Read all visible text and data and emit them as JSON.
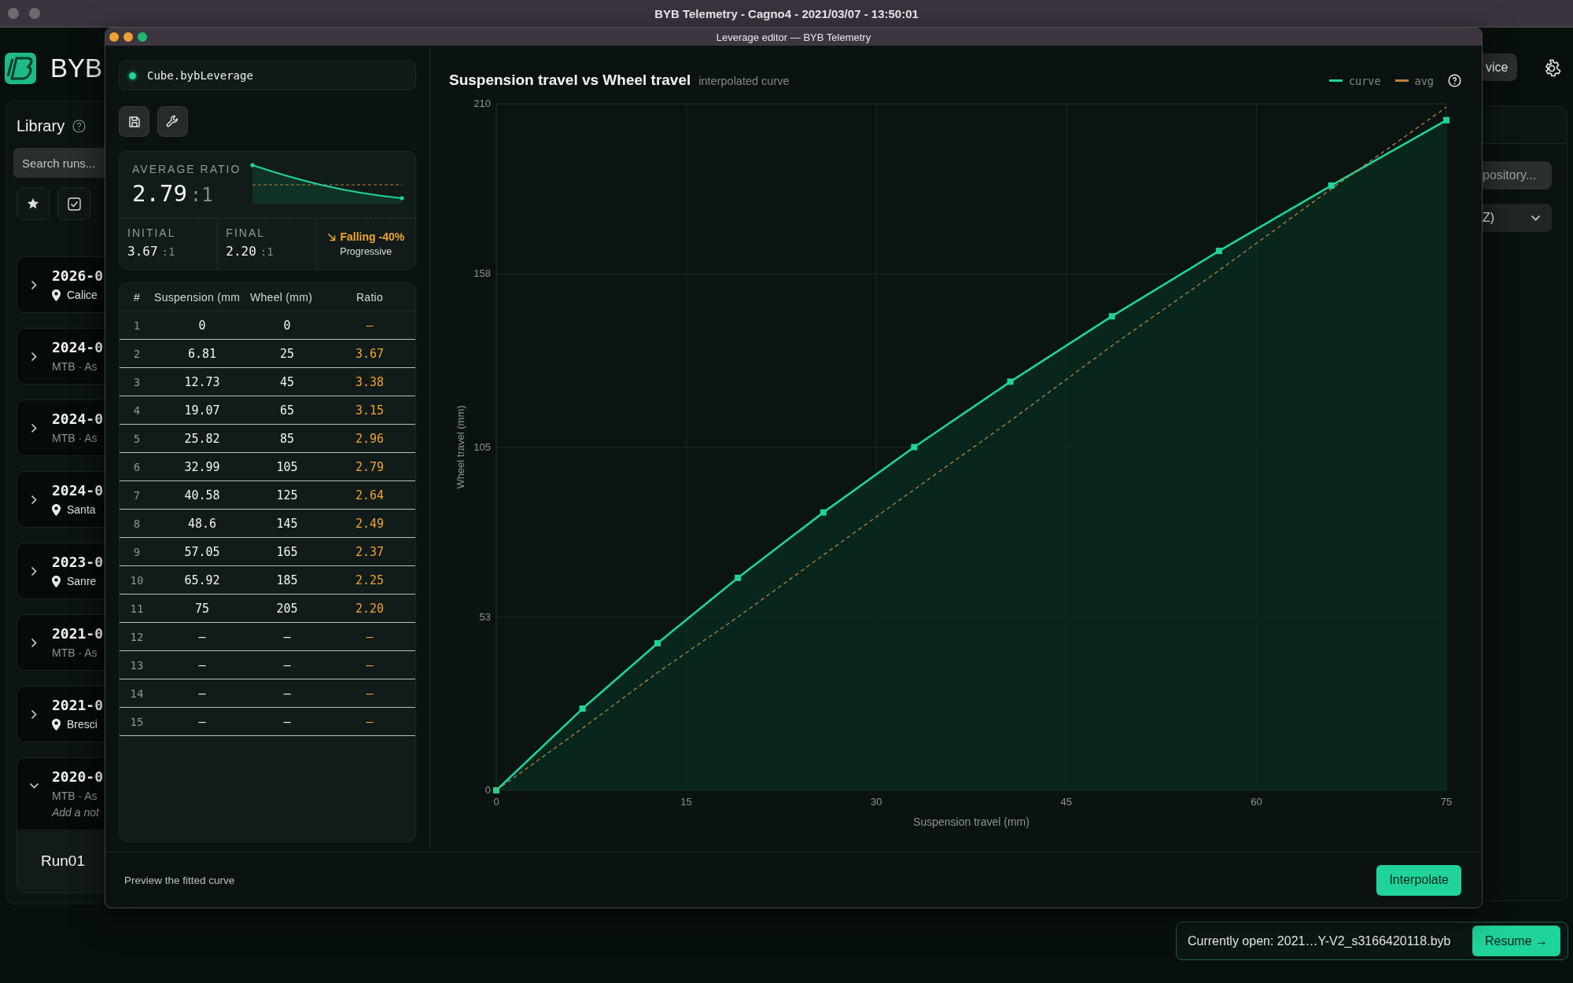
{
  "window": {
    "title": "BYB Telemetry - Cagno4 - 2021/03/07 - 13:50:01"
  },
  "brand": {
    "name": "BYB"
  },
  "library": {
    "title": "Library",
    "search": {
      "placeholder": "Search runs..."
    },
    "runs": [
      {
        "date": "2026-0",
        "kind": "place",
        "detail": "Calice",
        "expanded": false
      },
      {
        "date": "2024-0",
        "kind": "meta",
        "detail": "MTB · As",
        "expanded": false
      },
      {
        "date": "2024-0",
        "kind": "meta",
        "detail": "MTB · As",
        "expanded": false
      },
      {
        "date": "2024-0",
        "kind": "place",
        "detail": "Santa",
        "expanded": false
      },
      {
        "date": "2023-0",
        "kind": "place",
        "detail": "Sanre",
        "expanded": false
      },
      {
        "date": "2021-0",
        "kind": "meta",
        "detail": "MTB · As",
        "expanded": false
      },
      {
        "date": "2021-0",
        "kind": "place",
        "detail": "Bresci",
        "expanded": false
      },
      {
        "date": "2020-0",
        "kind": "meta",
        "detail": "MTB · As",
        "expanded": true,
        "note": "Add a not",
        "children": [
          {
            "name": "Run01"
          }
        ]
      }
    ]
  },
  "right_panel": {
    "device_button": "vice",
    "repository_field": {
      "placeholder": "pository..."
    },
    "dropdown": {
      "value": "Z)"
    }
  },
  "editor": {
    "title": "Leverage editor — BYB Telemetry",
    "file": "Cube.bybLeverage",
    "stats": {
      "label": "AVERAGE RATIO",
      "value": "2.79",
      "unit": ":1",
      "initial": {
        "label": "INITIAL",
        "value": "3.67",
        "unit": ":1"
      },
      "final": {
        "label": "FINAL",
        "value": "2.20",
        "unit": ":1"
      },
      "trend": {
        "text": "Falling -40%",
        "caption": "Progressive"
      }
    },
    "table": {
      "columns": [
        "#",
        "Suspension (mm",
        "Wheel (mm)",
        "Ratio"
      ],
      "rows": [
        {
          "index": "1",
          "suspension": "0",
          "wheel": "0",
          "ratio": "—"
        },
        {
          "index": "2",
          "suspension": "6.81",
          "wheel": "25",
          "ratio": "3.67"
        },
        {
          "index": "3",
          "suspension": "12.73",
          "wheel": "45",
          "ratio": "3.38"
        },
        {
          "index": "4",
          "suspension": "19.07",
          "wheel": "65",
          "ratio": "3.15"
        },
        {
          "index": "5",
          "suspension": "25.82",
          "wheel": "85",
          "ratio": "2.96"
        },
        {
          "index": "6",
          "suspension": "32.99",
          "wheel": "105",
          "ratio": "2.79"
        },
        {
          "index": "7",
          "suspension": "40.58",
          "wheel": "125",
          "ratio": "2.64"
        },
        {
          "index": "8",
          "suspension": "48.6",
          "wheel": "145",
          "ratio": "2.49"
        },
        {
          "index": "9",
          "suspension": "57.05",
          "wheel": "165",
          "ratio": "2.37"
        },
        {
          "index": "10",
          "suspension": "65.92",
          "wheel": "185",
          "ratio": "2.25"
        },
        {
          "index": "11",
          "suspension": "75",
          "wheel": "205",
          "ratio": "2.20"
        },
        {
          "index": "12",
          "suspension": "—",
          "wheel": "—",
          "ratio": "—"
        },
        {
          "index": "13",
          "suspension": "—",
          "wheel": "—",
          "ratio": "—"
        },
        {
          "index": "14",
          "suspension": "—",
          "wheel": "—",
          "ratio": "—"
        },
        {
          "index": "15",
          "suspension": "—",
          "wheel": "—",
          "ratio": "—"
        }
      ]
    },
    "chart": {
      "subtitle": "interpolated curve",
      "chart_data": {
        "type": "line",
        "title": "Suspension travel vs Wheel travel",
        "xlabel": "Suspension travel (mm)",
        "ylabel": "Wheel travel (mm)",
        "x": [
          0,
          6.81,
          12.73,
          19.07,
          25.82,
          32.99,
          40.58,
          48.6,
          57.05,
          65.92,
          75
        ],
        "series": [
          {
            "name": "curve",
            "color": "#1fd39a",
            "line_style": "solid",
            "marker": "square",
            "values": [
              0,
              25,
              45,
              65,
              85,
              105,
              125,
              145,
              165,
              185,
              205
            ]
          },
          {
            "name": "avg",
            "color": "#b8823e",
            "line_style": "dashed",
            "values": [
              0,
              19,
              36,
              53,
              72,
              92,
              113,
              136,
              159,
              184,
              209
            ]
          }
        ],
        "grid": true,
        "xlim": [
          0,
          75
        ],
        "ylim": [
          0,
          210
        ],
        "xticks": [
          0,
          15,
          30,
          45,
          60,
          75
        ],
        "yticks": [
          0,
          53,
          105,
          158,
          210
        ]
      }
    },
    "footer": {
      "hint": "Preview the fitted curve",
      "button": "Interpolate"
    }
  },
  "open_bar": {
    "label": "Currently open: 2021…Y-V2_s3166420118.byb",
    "button": "Resume →"
  }
}
